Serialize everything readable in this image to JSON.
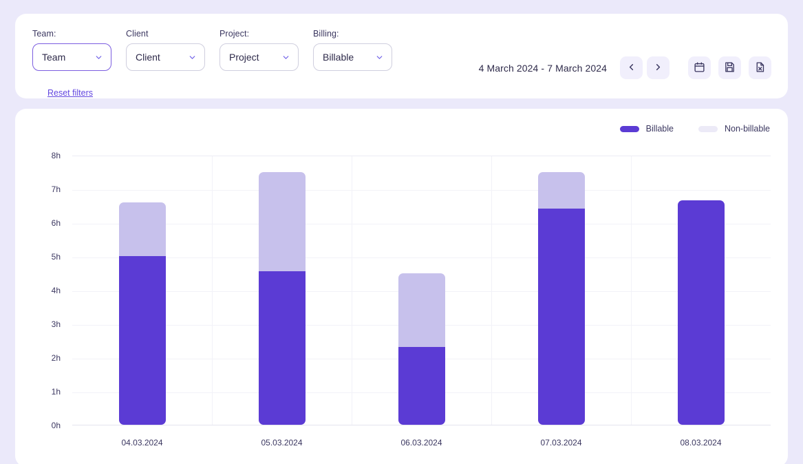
{
  "filters": {
    "items": [
      {
        "label": "Team:",
        "value": "Team",
        "name": "team",
        "accent": true
      },
      {
        "label": "Client",
        "value": "Client",
        "name": "client",
        "accent": false
      },
      {
        "label": "Project:",
        "value": "Project",
        "name": "project",
        "accent": false
      },
      {
        "label": "Billing:",
        "value": "Billable",
        "name": "billing",
        "accent": false
      }
    ],
    "reset_label": "Reset filters"
  },
  "toolbar": {
    "date_range": "4 March 2024 - 7 March 2024",
    "prev_label": "Previous period",
    "next_label": "Next period",
    "calendar_label": "Pick date range",
    "save_label": "Save report",
    "export_label": "Export to Excel"
  },
  "legend": [
    {
      "label": "Billable",
      "color": "#5b3bd4"
    },
    {
      "label": "Non-billable",
      "color": "#eceaf7"
    }
  ],
  "colors": {
    "billable": "#5b3bd4",
    "non_billable": "#c7c1ec",
    "page_background": "#ebe9fa",
    "card": "#ffffff",
    "accent": "#6246e0"
  },
  "chart_data": {
    "type": "bar",
    "stacked": true,
    "title": "",
    "xlabel": "",
    "ylabel": "",
    "categories": [
      "04.03.2024",
      "05.03.2024",
      "06.03.2024",
      "07.03.2024",
      "08.03.2024"
    ],
    "ytick_labels": [
      "0h",
      "1h",
      "2h",
      "3h",
      "4h",
      "5h",
      "6h",
      "7h",
      "8h"
    ],
    "ytick_values": [
      0,
      1,
      2,
      3,
      4,
      5,
      6,
      7,
      8
    ],
    "ylim": [
      0,
      8
    ],
    "grid": true,
    "legend_position": "top-right",
    "series": [
      {
        "name": "Billable",
        "color": "#5b3bd4",
        "values": [
          5.0,
          4.55,
          2.3,
          6.4,
          6.65
        ]
      },
      {
        "name": "Non-billable",
        "color": "#c7c1ec",
        "values": [
          1.6,
          2.95,
          2.2,
          1.1,
          0
        ]
      }
    ],
    "totals": [
      6.6,
      7.5,
      4.5,
      7.5,
      6.65
    ]
  }
}
